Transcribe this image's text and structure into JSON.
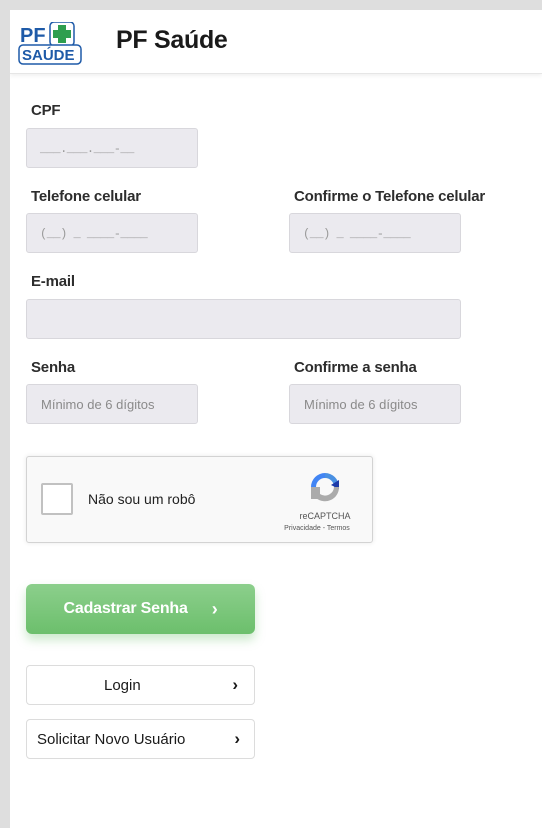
{
  "header": {
    "logo_text_top": "PF",
    "logo_text_bottom": "SAÚDE",
    "title": "PF Saúde"
  },
  "form": {
    "cpf": {
      "label": "CPF",
      "mask": "___.___.___-__",
      "value": ""
    },
    "phone": {
      "label": "Telefone celular",
      "mask": "(__) _ ____-____",
      "value": ""
    },
    "phone_confirm": {
      "label": "Confirme o Telefone celular",
      "mask": "(__) _ ____-____",
      "value": ""
    },
    "email": {
      "label": "E-mail",
      "value": ""
    },
    "password": {
      "label": "Senha",
      "placeholder": "Mínimo de 6 dígitos",
      "value": ""
    },
    "password_confirm": {
      "label": "Confirme a senha",
      "placeholder": "Mínimo de 6 dígitos",
      "value": ""
    }
  },
  "captcha": {
    "label": "Não sou um robô",
    "brand": "reCAPTCHA",
    "privacy": "Privacidade",
    "separator": " - ",
    "terms": "Termos",
    "checked": false
  },
  "buttons": {
    "submit": "Cadastrar Senha",
    "login": "Login",
    "new_user": "Solicitar Novo Usuário",
    "chevron": "›"
  },
  "colors": {
    "primary_button": "#7cc77c",
    "input_bg": "#ebeaef",
    "logo_blue": "#1e5aa8",
    "logo_green": "#2e9e4f"
  }
}
